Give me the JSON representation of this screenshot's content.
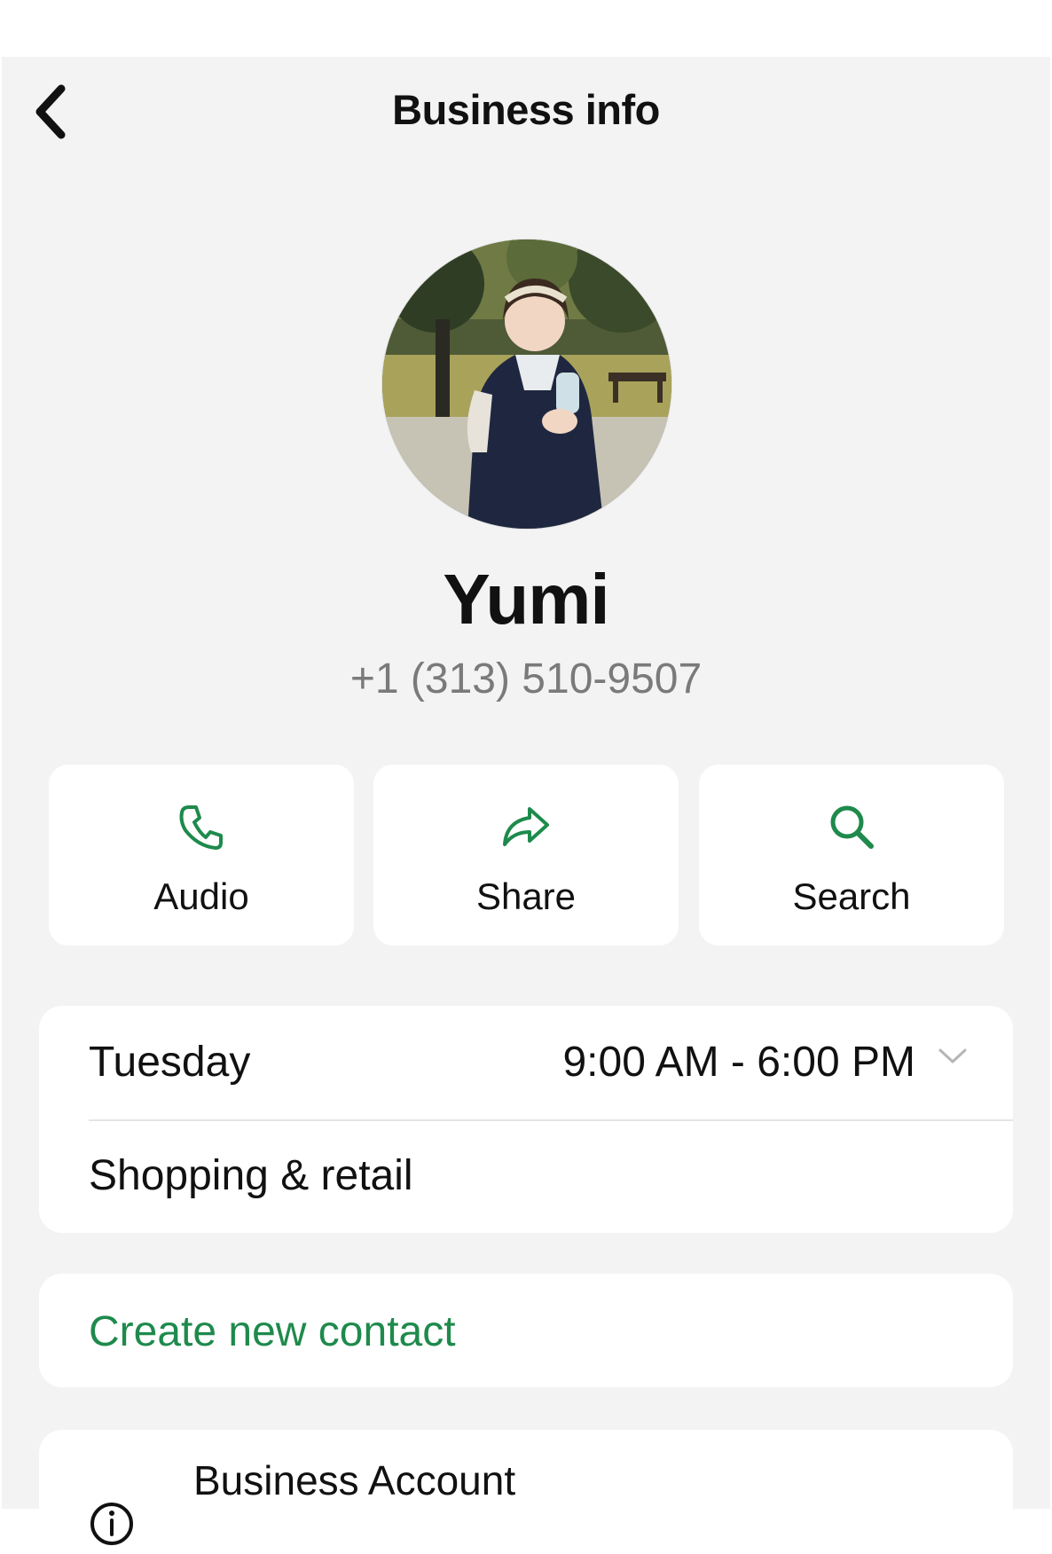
{
  "header": {
    "title": "Business info",
    "back_icon": "chevron-left-icon"
  },
  "profile": {
    "name": "Yumi",
    "phone": "+1 (313) 510-9507",
    "avatar_icon": "profile-photo"
  },
  "actions": [
    {
      "label": "Audio",
      "icon": "phone-icon"
    },
    {
      "label": "Share",
      "icon": "share-arrow-icon"
    },
    {
      "label": "Search",
      "icon": "search-icon"
    }
  ],
  "business_hours": {
    "day": "Tuesday",
    "hours": "9:00 AM - 6:00 PM",
    "expand_icon": "chevron-down-icon"
  },
  "category": "Shopping & retail",
  "create_contact_label": "Create new contact",
  "business_account": {
    "title": "Business Account",
    "icon": "info-icon"
  },
  "colors": {
    "accent_green": "#1e8a4c",
    "background": "#f3f3f3",
    "card": "#ffffff",
    "secondary_text": "#7a7a7a"
  }
}
